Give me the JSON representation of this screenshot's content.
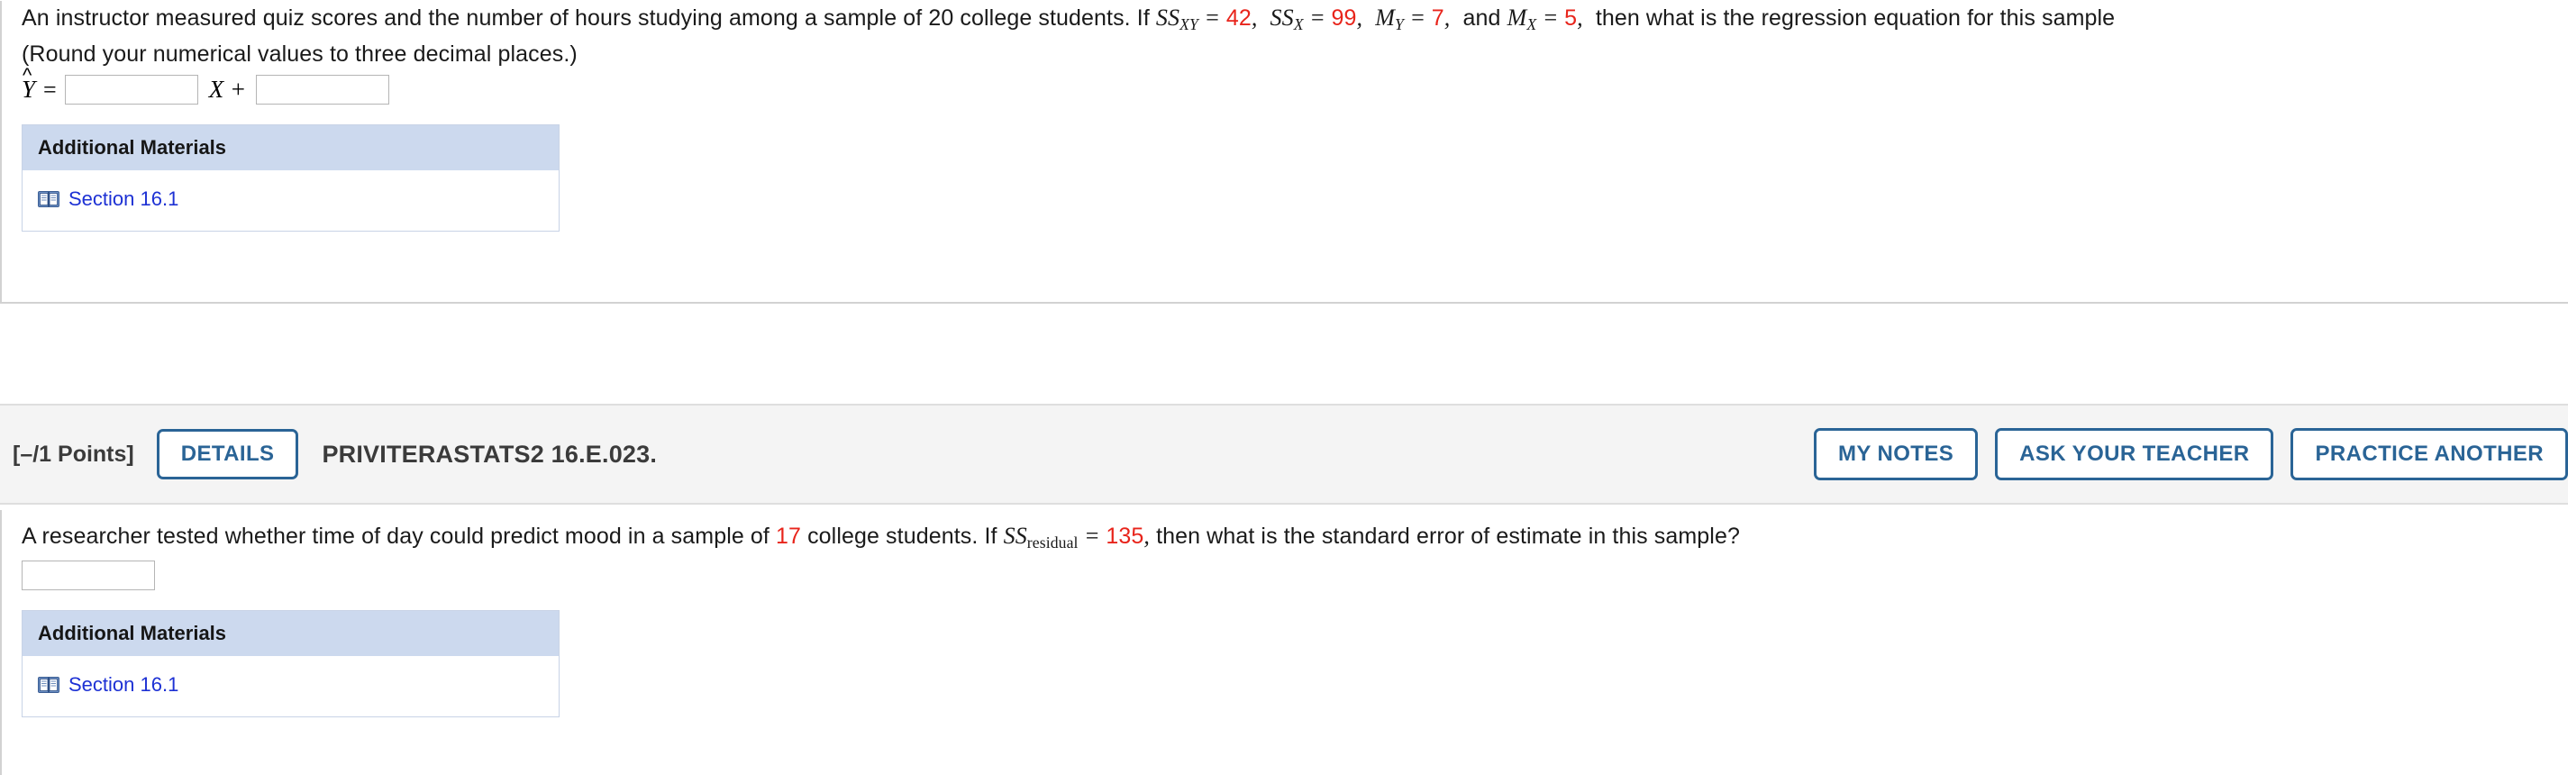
{
  "colors": {
    "highlight_number": "#e8241b",
    "link": "#1d31d4",
    "button_border": "#2a6496",
    "materials_header_bg": "#ccd9ee",
    "header_bar_bg": "#f4f4f4"
  },
  "question_1": {
    "prompt_line_1_a": "An instructor measured quiz scores and the number of hours studying among a sample of 20 college students. If ",
    "ss_xy_label": "SS",
    "ss_xy_sub": "XY",
    "ss_xy_eq": " = ",
    "ss_xy_value": "42",
    "ss_xy_comma": ",",
    "ss_x_label": "SS",
    "ss_x_sub": "X",
    "ss_x_eq": " = ",
    "ss_x_value": "99",
    "ss_x_comma": ",",
    "m_y_label": "M",
    "m_y_sub": "Y",
    "m_y_eq": " = ",
    "m_y_value": "7",
    "m_y_comma": ",",
    "and_word": "and",
    "m_x_label": "M",
    "m_x_sub": "X",
    "m_x_eq": " = ",
    "m_x_value": "5",
    "m_x_comma": ",",
    "prompt_line_1_b": "then what is the regression equation for this sample",
    "prompt_line_2": "(Round your numerical values to three decimal places.)",
    "yhat_symbol": "Y",
    "yhat_hat": "^",
    "equals": "=",
    "slope_input_value": "",
    "slope_input_placeholder": "",
    "x_plus": "X +",
    "intercept_input_value": "",
    "intercept_input_placeholder": "",
    "materials": {
      "title": "Additional Materials",
      "link_label": "Section 16.1",
      "link_icon": "book-icon"
    }
  },
  "question_2": {
    "header": {
      "points": "[–/1 Points]",
      "details_button": "DETAILS",
      "question_code": "PRIVITERASTATS2 16.E.023.",
      "my_notes_button": "MY NOTES",
      "ask_teacher_button": "ASK YOUR TEACHER",
      "practice_another_button": "PRACTICE ANOTHER"
    },
    "prompt_a": "A researcher tested whether time of day could predict mood in a sample of ",
    "sample_size": "17",
    "prompt_b": " college students. If ",
    "ss_residual_label": "SS",
    "ss_residual_sub": "residual",
    "ss_residual_eq": " = ",
    "ss_residual_value": "135",
    "ss_residual_comma": ",",
    "prompt_c": " then what is the standard error of estimate in this sample?",
    "answer_input_value": "",
    "answer_input_placeholder": "",
    "materials": {
      "title": "Additional Materials",
      "link_label": "Section 16.1",
      "link_icon": "book-icon"
    }
  }
}
